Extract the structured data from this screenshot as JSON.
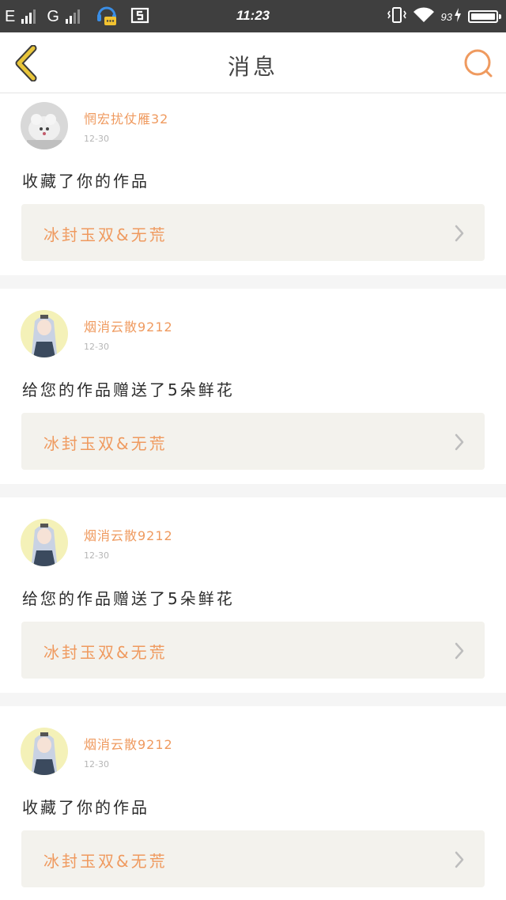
{
  "status_bar": {
    "carrier_1": "E",
    "carrier_2": "G",
    "time": "11:23",
    "battery_pct": "93",
    "icons": [
      "signal-icon",
      "headset-notification-icon",
      "screenshot-icon",
      "vibrate-icon",
      "wifi-icon",
      "charging-icon",
      "battery-icon"
    ]
  },
  "nav": {
    "title": "消息",
    "back_icon": "chevron-left-icon",
    "search_icon": "search-icon"
  },
  "colors": {
    "accent": "#ef9a5f",
    "back_icon": "#e8c53a",
    "status_bar": "#3f3f3f",
    "work_box": "#f3f2ed",
    "separator": "#f5f5f5"
  },
  "messages": [
    {
      "user": "惘宏扰仗雁32",
      "date": "12-30",
      "action": "收藏了你的作品",
      "work": "冰封玉双&无荒",
      "avatar": "plush-toy-avatar"
    },
    {
      "user": "烟消云散9212",
      "date": "12-30",
      "action": "给您的作品赠送了5朵鲜花",
      "work": "冰封玉双&无荒",
      "avatar": "anime-girl-avatar"
    },
    {
      "user": "烟消云散9212",
      "date": "12-30",
      "action": "给您的作品赠送了5朵鲜花",
      "work": "冰封玉双&无荒",
      "avatar": "anime-girl-avatar"
    },
    {
      "user": "烟消云散9212",
      "date": "12-30",
      "action": "收藏了你的作品",
      "work": "冰封玉双&无荒",
      "avatar": "anime-girl-avatar"
    }
  ]
}
